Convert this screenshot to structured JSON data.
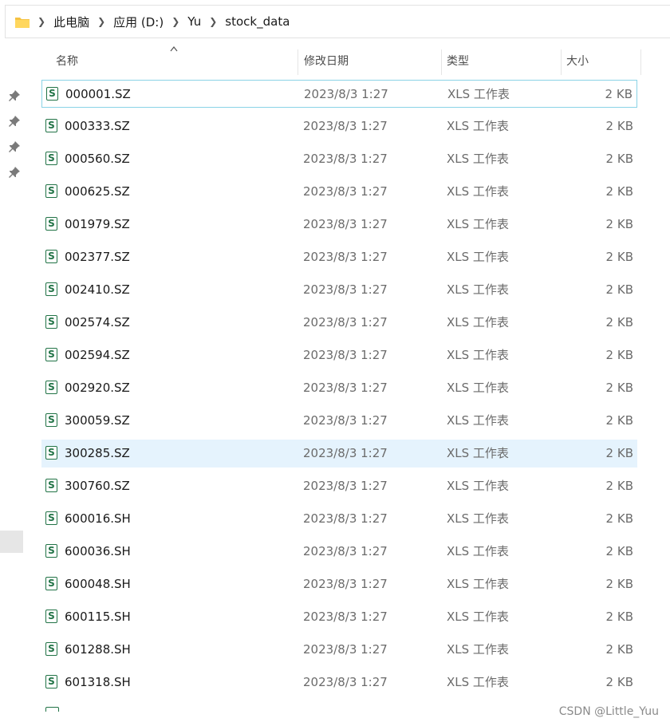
{
  "breadcrumb": {
    "icon": "folder-icon",
    "items": [
      "此电脑",
      "应用 (D:)",
      "Yu",
      "stock_data"
    ]
  },
  "columns": {
    "name": "名称",
    "date": "修改日期",
    "type": "类型",
    "size": "大小"
  },
  "file_icon": "xls-spreadsheet-icon",
  "file_icon_glyph": "S",
  "files": [
    {
      "name": "000001.SZ",
      "date": "2023/8/3 1:27",
      "type": "XLS 工作表",
      "size": "2 KB"
    },
    {
      "name": "000333.SZ",
      "date": "2023/8/3 1:27",
      "type": "XLS 工作表",
      "size": "2 KB"
    },
    {
      "name": "000560.SZ",
      "date": "2023/8/3 1:27",
      "type": "XLS 工作表",
      "size": "2 KB"
    },
    {
      "name": "000625.SZ",
      "date": "2023/8/3 1:27",
      "type": "XLS 工作表",
      "size": "2 KB"
    },
    {
      "name": "001979.SZ",
      "date": "2023/8/3 1:27",
      "type": "XLS 工作表",
      "size": "2 KB"
    },
    {
      "name": "002377.SZ",
      "date": "2023/8/3 1:27",
      "type": "XLS 工作表",
      "size": "2 KB"
    },
    {
      "name": "002410.SZ",
      "date": "2023/8/3 1:27",
      "type": "XLS 工作表",
      "size": "2 KB"
    },
    {
      "name": "002574.SZ",
      "date": "2023/8/3 1:27",
      "type": "XLS 工作表",
      "size": "2 KB"
    },
    {
      "name": "002594.SZ",
      "date": "2023/8/3 1:27",
      "type": "XLS 工作表",
      "size": "2 KB"
    },
    {
      "name": "002920.SZ",
      "date": "2023/8/3 1:27",
      "type": "XLS 工作表",
      "size": "2 KB"
    },
    {
      "name": "300059.SZ",
      "date": "2023/8/3 1:27",
      "type": "XLS 工作表",
      "size": "2 KB"
    },
    {
      "name": "300285.SZ",
      "date": "2023/8/3 1:27",
      "type": "XLS 工作表",
      "size": "2 KB"
    },
    {
      "name": "300760.SZ",
      "date": "2023/8/3 1:27",
      "type": "XLS 工作表",
      "size": "2 KB"
    },
    {
      "name": "600016.SH",
      "date": "2023/8/3 1:27",
      "type": "XLS 工作表",
      "size": "2 KB"
    },
    {
      "name": "600036.SH",
      "date": "2023/8/3 1:27",
      "type": "XLS 工作表",
      "size": "2 KB"
    },
    {
      "name": "600048.SH",
      "date": "2023/8/3 1:27",
      "type": "XLS 工作表",
      "size": "2 KB"
    },
    {
      "name": "600115.SH",
      "date": "2023/8/3 1:27",
      "type": "XLS 工作表",
      "size": "2 KB"
    },
    {
      "name": "601288.SH",
      "date": "2023/8/3 1:27",
      "type": "XLS 工作表",
      "size": "2 KB"
    },
    {
      "name": "601318.SH",
      "date": "2023/8/3 1:27",
      "type": "XLS 工作表",
      "size": "2 KB"
    }
  ],
  "focused_row": 0,
  "hovered_row": 11,
  "watermark": "CSDN @Little_Yuu",
  "colors": {
    "xls_green": "#217346",
    "hover": "#e5f3fd",
    "focus_border": "#8ad3e6",
    "folder": "#f5c242"
  }
}
